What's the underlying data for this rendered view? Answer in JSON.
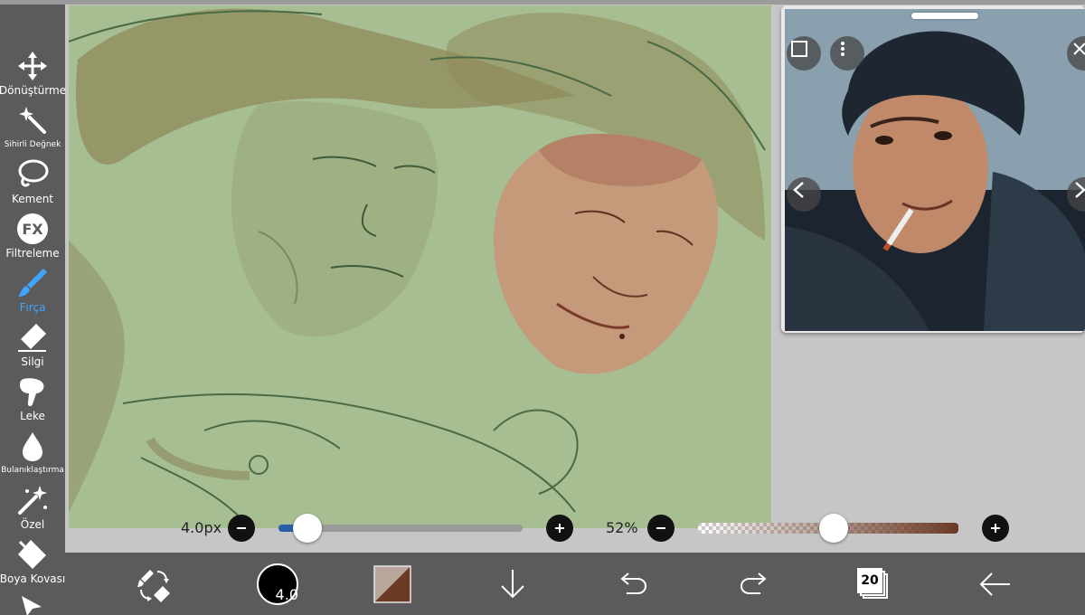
{
  "toolbar": {
    "items": [
      {
        "label": "Dönüştürme",
        "icon": "move-arrows-icon"
      },
      {
        "label": "Sihirli Değnek",
        "icon": "magic-wand-icon"
      },
      {
        "label": "Kement",
        "icon": "lasso-icon"
      },
      {
        "label": "Filtreleme",
        "icon": "fx-icon",
        "badge": "FX"
      },
      {
        "label": "Fırça",
        "icon": "brush-icon",
        "active": true
      },
      {
        "label": "Silgi",
        "icon": "eraser-icon"
      },
      {
        "label": "Leke",
        "icon": "smudge-finger-icon"
      },
      {
        "label": "Bulanıklaştırma",
        "icon": "blur-drop-icon"
      },
      {
        "label": "Özel",
        "icon": "sparkle-icon"
      },
      {
        "label": "Boya Kovası",
        "icon": "paint-bucket-icon"
      }
    ]
  },
  "brush": {
    "size_label": "4.0px",
    "size_fraction": 0.12,
    "opacity_label": "52%",
    "opacity_fraction": 0.52
  },
  "bottom_bar": {
    "brush_size_display": "4.0",
    "layer_count": "20",
    "primary_color": "#6b3a26",
    "secondary_color": "#b8a79a"
  },
  "colors": {
    "accent": "#3fa6ff",
    "toolbar_bg": "#5b5b5b",
    "canvas_bg": "#a7be93"
  }
}
